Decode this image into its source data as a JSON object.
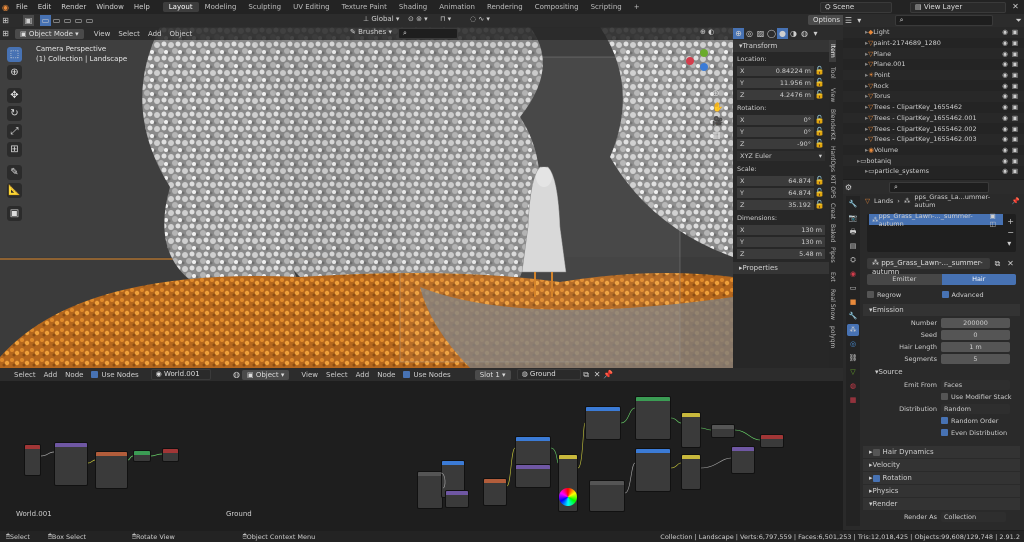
{
  "topbar": {
    "menus": [
      "File",
      "Edit",
      "Render",
      "Window",
      "Help"
    ],
    "workspaces": [
      "Layout",
      "Modeling",
      "Sculpting",
      "UV Editing",
      "Texture Paint",
      "Shading",
      "Animation",
      "Rendering",
      "Compositing",
      "Scripting"
    ],
    "active_workspace": "Layout",
    "scene": "Scene",
    "view_layer": "View Layer"
  },
  "viewport_header": {
    "mode": "Object Mode",
    "menus": [
      "View",
      "Select",
      "Add",
      "Object"
    ],
    "orientation": "Global",
    "options": "Options",
    "brushes": "Brushes"
  },
  "viewport": {
    "camera_label": "Camera Perspective",
    "collection_label": "(1) Collection | Landscape"
  },
  "transform": {
    "title": "Transform",
    "location_label": "Location:",
    "location": [
      {
        "axis": "X",
        "value": "0.84224 m"
      },
      {
        "axis": "Y",
        "value": "11.956 m"
      },
      {
        "axis": "Z",
        "value": "4.2476 m"
      }
    ],
    "rotation_label": "Rotation:",
    "rotation": [
      {
        "axis": "X",
        "value": "0°"
      },
      {
        "axis": "Y",
        "value": "0°"
      },
      {
        "axis": "Z",
        "value": "-90°"
      }
    ],
    "rotation_mode": "XYZ Euler",
    "scale_label": "Scale:",
    "scale": [
      {
        "axis": "X",
        "value": "64.874"
      },
      {
        "axis": "Y",
        "value": "64.874"
      },
      {
        "axis": "Z",
        "value": "35.192"
      }
    ],
    "dimensions_label": "Dimensions:",
    "dimensions": [
      {
        "axis": "X",
        "value": "130 m"
      },
      {
        "axis": "Y",
        "value": "130 m"
      },
      {
        "axis": "Z",
        "value": "5.48 m"
      }
    ],
    "properties_label": "Properties"
  },
  "side_tabs": [
    "Item",
    "Tool",
    "View",
    "BlenderKit",
    "HardOps",
    "KIT OPS",
    "Creat",
    "Baked",
    "Pipes",
    "Ext",
    "Real Snow",
    "polyqm"
  ],
  "outliner": {
    "rows": [
      "Light",
      "paint-2174689_1280",
      "Plane",
      "Plane.001",
      "Point",
      "Rock",
      "Torus",
      "Trees - ClipartKey_1655462",
      "Trees - ClipartKey_1655462.001",
      "Trees - ClipartKey_1655462.002",
      "Trees - ClipartKey_1655462.003",
      "Volume",
      "botaniq",
      "particle_systems"
    ]
  },
  "properties": {
    "breadcrumb_object": "Lands",
    "breadcrumb_system": "pps_Grass_La...ummer-autum",
    "system_list_item": "pps_Grass_Lawn-..._summer-autumn",
    "system_name": "pps_Grass_Lawn-..._summer-autumn",
    "type_emitter": "Emitter",
    "type_hair": "Hair",
    "regrow": "Regrow",
    "advanced": "Advanced",
    "emission": {
      "title": "Emission",
      "rows": [
        {
          "label": "Number",
          "value": "200000"
        },
        {
          "label": "Seed",
          "value": "0"
        },
        {
          "label": "Hair Length",
          "value": "1 m"
        },
        {
          "label": "Segments",
          "value": "5"
        }
      ]
    },
    "source": {
      "title": "Source",
      "emit_from_label": "Emit From",
      "emit_from": "Faces",
      "use_modifier_stack": "Use Modifier Stack",
      "distribution_label": "Distribution",
      "distribution": "Random",
      "random_order": "Random Order",
      "even_distribution": "Even Distribution"
    },
    "collapsed": [
      "Hair Dynamics",
      "Velocity",
      "Rotation",
      "Physics",
      "Render"
    ],
    "render_as_label": "Render As",
    "render_as": "Collection"
  },
  "world_editor": {
    "menus": [
      "Select",
      "Add",
      "Node"
    ],
    "use_nodes": "Use Nodes",
    "world": "World.001",
    "label": "World.001"
  },
  "shader_editor": {
    "object": "Object",
    "menus": [
      "View",
      "Select",
      "Add",
      "Node"
    ],
    "use_nodes": "Use Nodes",
    "slot": "Slot 1",
    "material": "Ground",
    "label": "Ground"
  },
  "statusbar": {
    "items": [
      "Select",
      "Box Select",
      "Rotate View",
      "Object Context Menu"
    ],
    "stats": "Collection | Landscape | Verts:6,797,559 | Faces:6,501,253 | Tris:12,018,425 | Objects:99,608/129,748 | 2.91.2"
  },
  "colors": {
    "accent": "#4772b3",
    "selected": "#ff9a2e",
    "orange": "#d4832a"
  }
}
